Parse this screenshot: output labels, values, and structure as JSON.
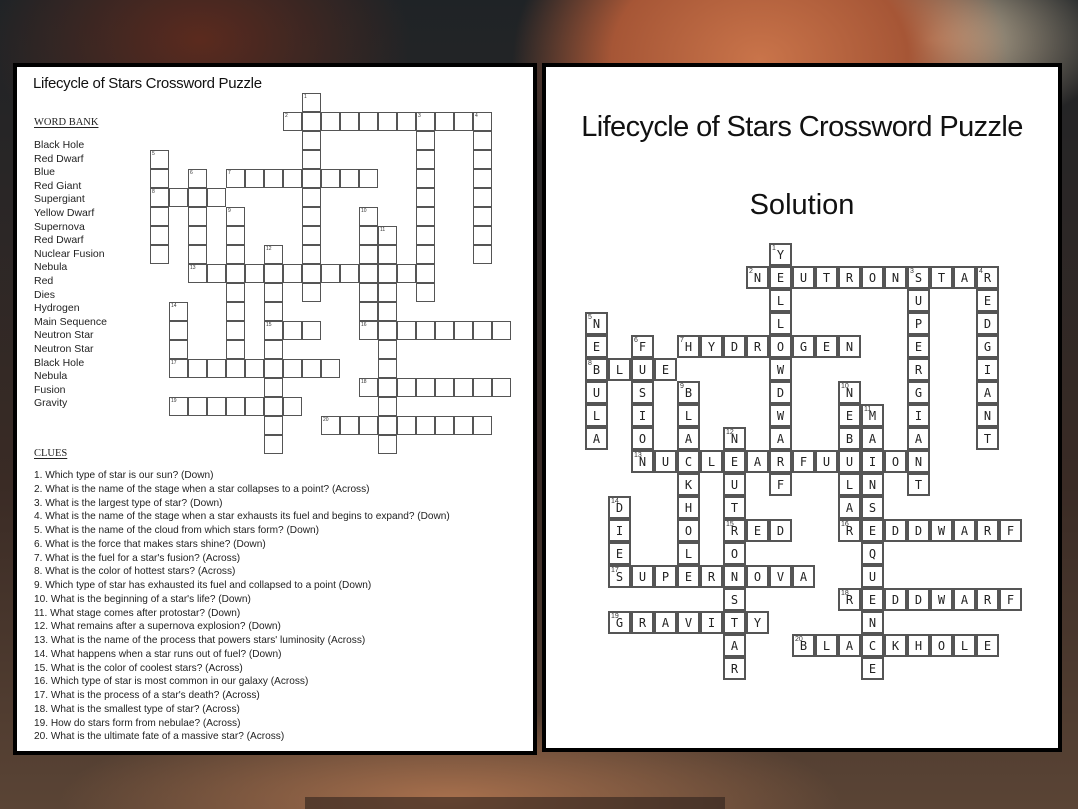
{
  "puzzle": {
    "title": "Lifecycle of Stars Crossword Puzzle",
    "word_bank_heading": "WORD BANK",
    "word_bank": [
      "Black Hole",
      "Red Dwarf",
      "Blue",
      "Red Giant",
      "Supergiant",
      "Yellow Dwarf",
      "Supernova",
      "Red Dwarf",
      "Nuclear Fusion",
      "Nebula",
      "Red",
      "Dies",
      "Hydrogen",
      "Main Sequence",
      "Neutron Star",
      "Neutron Star",
      "Black Hole",
      "Nebula",
      "Fusion",
      "Gravity"
    ],
    "clues_heading": "CLUES",
    "clues": [
      "1. Which type of star is our sun? (Down)",
      "2. What is the name of the stage when a star collapses to a point? (Across)",
      "3. What is the largest type of star? (Down)",
      "4. What is the name of the stage when a star exhausts its fuel and begins to expand? (Down)",
      "5. What is the name of the cloud from which stars form? (Down)",
      "6. What is the force that makes stars shine? (Down)",
      "7. What is the fuel for a star's fusion? (Across)",
      "8. What is the color of hottest stars? (Across)",
      "9. Which type of star has exhausted its fuel and collapsed to a point (Down)",
      "10. What is the beginning of a star's life? (Down)",
      "11. What stage comes after protostar? (Down)",
      "12. What remains after a supernova explosion? (Down)",
      "13. What is the name of the process that powers stars' luminosity (Across)",
      "14. What happens when a star runs out of fuel? (Down)",
      "15. What is the color of coolest stars? (Across)",
      "16. Which type of star is most common in our galaxy (Across)",
      "17. What is the process of a star's death? (Across)",
      "18. What is the smallest type of star? (Across)",
      "19. How do stars form from nebulae? (Across)",
      "20. What is the ultimate fate of a massive star? (Across)"
    ]
  },
  "solution": {
    "title": "Lifecycle of Stars Crossword Puzzle",
    "subtitle": "Solution"
  },
  "entries": [
    {
      "number": 1,
      "direction": "down",
      "answer": "YELLOWDWARF",
      "row": 0,
      "col": 8
    },
    {
      "number": 2,
      "direction": "across",
      "answer": "NEUTRONSTAR",
      "row": 1,
      "col": 7
    },
    {
      "number": 3,
      "direction": "down",
      "answer": "SUPERGIANT",
      "row": 1,
      "col": 14
    },
    {
      "number": 4,
      "direction": "down",
      "answer": "REDGIANT",
      "row": 1,
      "col": 17
    },
    {
      "number": 5,
      "direction": "down",
      "answer": "NEBULA",
      "row": 3,
      "col": 0
    },
    {
      "number": 6,
      "direction": "down",
      "answer": "FUSION",
      "row": 4,
      "col": 2
    },
    {
      "number": 7,
      "direction": "across",
      "answer": "HYDROGEN",
      "row": 4,
      "col": 4
    },
    {
      "number": 8,
      "direction": "across",
      "answer": "BLUE",
      "row": 5,
      "col": 0
    },
    {
      "number": 9,
      "direction": "down",
      "answer": "BLACKHOLE",
      "row": 6,
      "col": 4
    },
    {
      "number": 10,
      "direction": "down",
      "answer": "NEBULA",
      "row": 6,
      "col": 11
    },
    {
      "number": 11,
      "direction": "down",
      "answer": "MAINSEQUENCE",
      "row": 7,
      "col": 12
    },
    {
      "number": 12,
      "direction": "down",
      "answer": "NEUTRONSTAR",
      "row": 8,
      "col": 6
    },
    {
      "number": 13,
      "direction": "across",
      "answer": "NUCLEARFUSION",
      "row": 9,
      "col": 2
    },
    {
      "number": 14,
      "direction": "down",
      "answer": "DIE",
      "row": 11,
      "col": 1
    },
    {
      "number": 15,
      "direction": "across",
      "answer": "RED",
      "row": 12,
      "col": 6
    },
    {
      "number": 16,
      "direction": "across",
      "answer": "REDDWARF",
      "row": 12,
      "col": 11
    },
    {
      "number": 17,
      "direction": "across",
      "answer": "SUPERNOVA",
      "row": 14,
      "col": 1
    },
    {
      "number": 18,
      "direction": "across",
      "answer": "REDDWARF",
      "row": 15,
      "col": 11
    },
    {
      "number": 19,
      "direction": "across",
      "answer": "GRAVITY",
      "row": 16,
      "col": 1
    },
    {
      "number": 20,
      "direction": "across",
      "answer": "BLACKHOLE",
      "row": 17,
      "col": 9
    }
  ]
}
